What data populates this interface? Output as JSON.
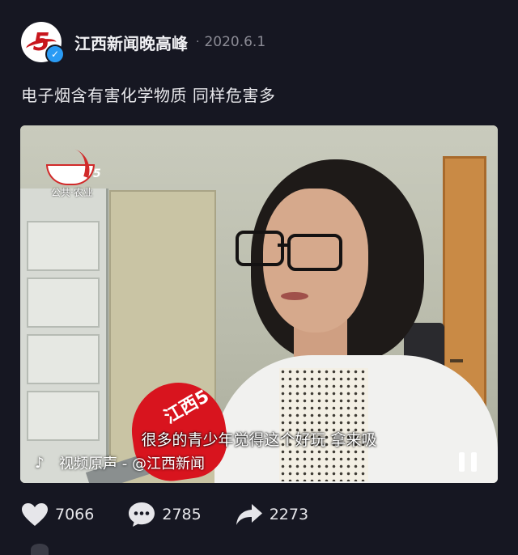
{
  "post": {
    "account_name": "江西新闻晚高峰",
    "separator": "·",
    "date": "2020.6.1",
    "caption": "电子烟含有害化学物质 同样危害多"
  },
  "video": {
    "station_logo_text": "公共·农业",
    "station_logo_number": "5",
    "mic_label": "江西5",
    "subtitle": "很多的青少年觉得这个好玩 拿来吸",
    "watermark": "视频原声 - @江西新闻"
  },
  "actions": {
    "likes": "7066",
    "comments": "2785",
    "shares": "2273"
  },
  "colors": {
    "background": "#161722",
    "accent_verified": "#2a9bf4",
    "brand_red": "#c8161d"
  },
  "icons": [
    "verified-badge-icon",
    "tiktok-icon",
    "pause-icon",
    "heart-icon",
    "comment-icon",
    "share-icon"
  ]
}
